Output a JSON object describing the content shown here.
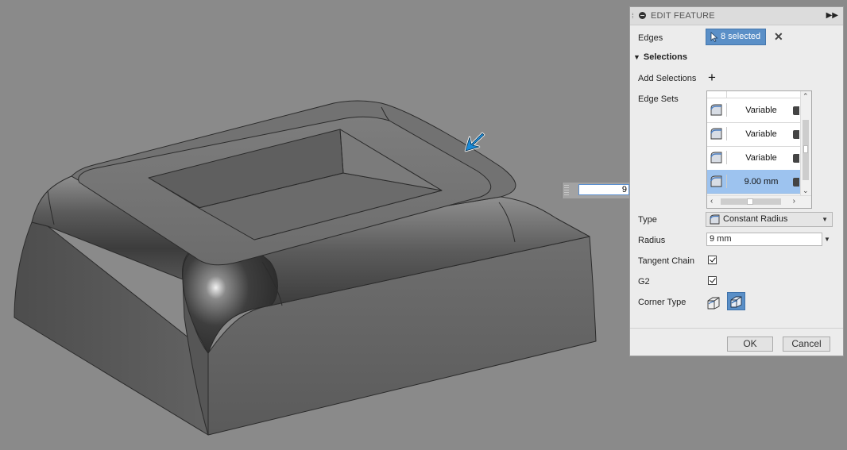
{
  "viewport": {
    "inline_input_value": "9"
  },
  "panel": {
    "title": "EDIT FEATURE",
    "edges": {
      "label": "Edges",
      "value": "8 selected"
    },
    "selections_header": "Selections",
    "add_selections_label": "Add Selections",
    "edge_sets": {
      "label": "Edge Sets",
      "rows": [
        {
          "value": "Variable",
          "selected": false
        },
        {
          "value": "Variable",
          "selected": false
        },
        {
          "value": "Variable",
          "selected": false
        },
        {
          "value": "9.00 mm",
          "selected": true
        }
      ]
    },
    "type": {
      "label": "Type",
      "value": "Constant Radius"
    },
    "radius": {
      "label": "Radius",
      "value": "9 mm"
    },
    "tangent_chain": {
      "label": "Tangent Chain",
      "checked": true
    },
    "g2": {
      "label": "G2",
      "checked": true
    },
    "corner_type": {
      "label": "Corner Type"
    },
    "ok_label": "OK",
    "cancel_label": "Cancel"
  },
  "colors": {
    "accent": "#5a8fc7",
    "background": "#8a8a8a",
    "selected_row": "#9dc3ef"
  }
}
